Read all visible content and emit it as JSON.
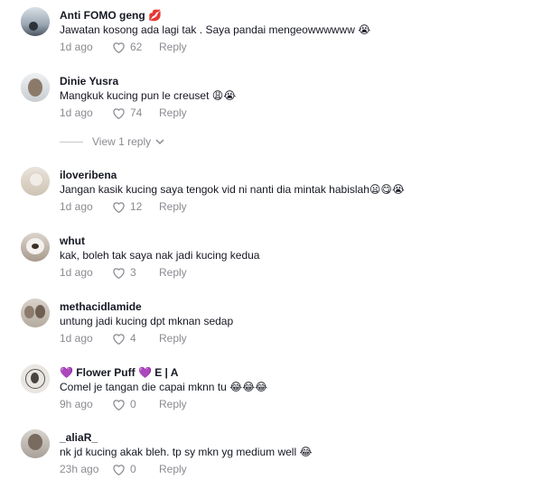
{
  "comments": [
    {
      "name": "Anti FOMO geng 💋",
      "text": "Jawatan kosong ada lagi tak . Saya pandai mengeowwwwww 😭",
      "time": "1d ago",
      "likes": "62",
      "reply": "Reply"
    },
    {
      "name": "Dinie Yusra",
      "text": "Mangkuk kucing pun le creuset 😩😭",
      "time": "1d ago",
      "likes": "74",
      "reply": "Reply"
    },
    {
      "name": "iloveribena",
      "text": "Jangan kasik kucing saya tengok vid ni nanti dia mintak habislah😦😋😭",
      "time": "1d ago",
      "likes": "12",
      "reply": "Reply"
    },
    {
      "name": "whut",
      "text": "kak, boleh tak saya nak jadi kucing kedua",
      "time": "1d ago",
      "likes": "3",
      "reply": "Reply"
    },
    {
      "name": "methacidlamide",
      "text": "untung jadi kucing dpt mknan sedap",
      "time": "1d ago",
      "likes": "4",
      "reply": "Reply"
    },
    {
      "name": "💜 Flower Puff 💜 E | A",
      "text": "Comel je tangan die capai mknn tu 😂😂😂",
      "time": "9h ago",
      "likes": "0",
      "reply": "Reply"
    },
    {
      "name": "_aliaR_",
      "text": "nk jd kucing akak bleh. tp sy mkn yg medium well 😂",
      "time": "23h ago",
      "likes": "0",
      "reply": "Reply"
    }
  ],
  "view_replies": {
    "label": "View 1 reply"
  },
  "colors": {
    "text": "#161823",
    "muted": "#8a8b91",
    "background": "#ffffff"
  },
  "icons": {
    "like": "heart-outline-icon",
    "expand": "chevron-down-icon"
  }
}
